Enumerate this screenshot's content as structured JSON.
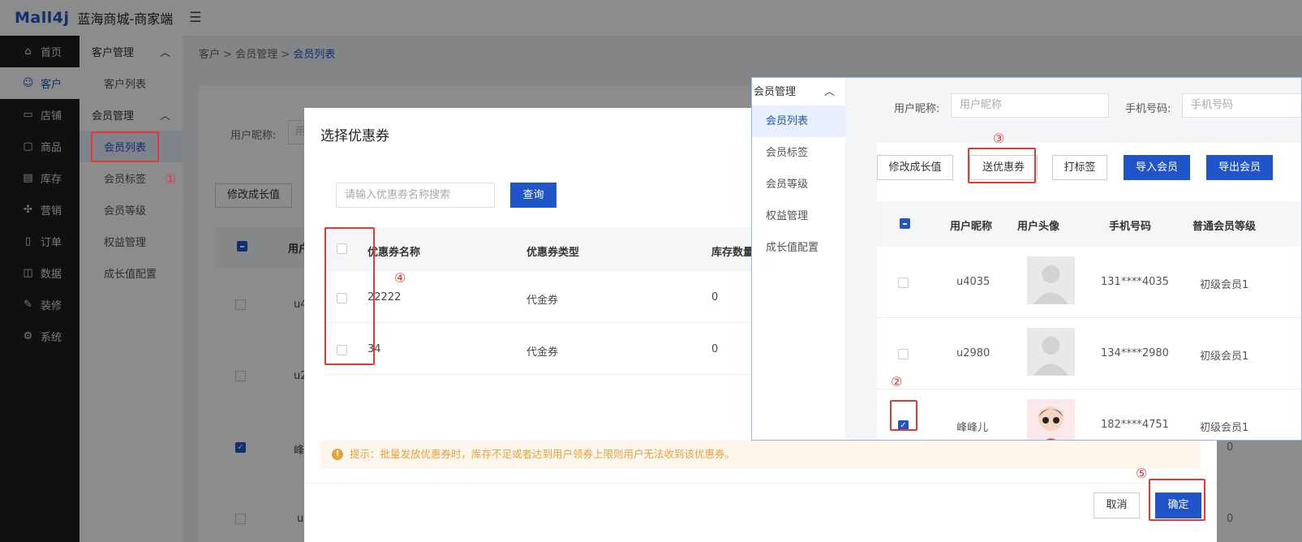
{
  "header": {
    "logo": "Mall4j",
    "app_title": "蓝海商城-商家端",
    "menu_icon": "menu-fold-icon"
  },
  "sidebar": {
    "items": [
      {
        "label": "首页",
        "icon": "home-icon"
      },
      {
        "label": "客户",
        "icon": "users-icon",
        "active": true
      },
      {
        "label": "店铺",
        "icon": "shop-icon"
      },
      {
        "label": "商品",
        "icon": "bag-icon"
      },
      {
        "label": "库存",
        "icon": "store-icon"
      },
      {
        "label": "营销",
        "icon": "gift-icon"
      },
      {
        "label": "订单",
        "icon": "file-icon"
      },
      {
        "label": "数据",
        "icon": "chart-icon"
      },
      {
        "label": "装修",
        "icon": "brush-icon"
      },
      {
        "label": "系统",
        "icon": "gear-icon"
      }
    ]
  },
  "subnav": {
    "group1": "客户管理",
    "group1_items": [
      "客户列表"
    ],
    "group2": "会员管理",
    "group2_items": [
      "会员列表",
      "会员标签",
      "会员等级",
      "权益管理",
      "成长值配置"
    ]
  },
  "breadcrumb": [
    "客户",
    "会员管理",
    "会员列表"
  ],
  "background": {
    "search_label": "用户昵称:",
    "search_placeholder": "用",
    "button": "修改成长值",
    "col_header": "用户",
    "rows": [
      "u4",
      "u2",
      "峰",
      "u"
    ],
    "zero_values": [
      "0",
      "0"
    ]
  },
  "dialog": {
    "title": "选择优惠券",
    "search_placeholder": "请输入优惠券名称搜索",
    "query_button": "查询",
    "columns": [
      "优惠券名称",
      "优惠券类型",
      "库存数量"
    ],
    "rows": [
      {
        "name": "22222",
        "type": "代金券",
        "stock": "0"
      },
      {
        "name": "34",
        "type": "代金券",
        "stock": "0"
      }
    ],
    "tip": "提示：批量发放优惠券时，库存不足或者达到用户领券上限则用户无法收到该优惠券。",
    "cancel": "取消",
    "confirm": "确定"
  },
  "inset": {
    "group": "会员管理",
    "items": [
      "会员列表",
      "会员标签",
      "会员等级",
      "权益管理",
      "成长值配置"
    ],
    "search": {
      "nickname_label": "用户昵称:",
      "nickname_placeholder": "用户昵称",
      "phone_label": "手机号码:",
      "phone_placeholder": "手机号码"
    },
    "buttons": [
      "修改成长值",
      "送优惠券",
      "打标签",
      "导入会员",
      "导出会员"
    ],
    "columns": [
      "用户昵称",
      "用户头像",
      "手机号码",
      "普通会员等级"
    ],
    "rows": [
      {
        "nickname": "u4035",
        "phone": "131****4035",
        "level": "初级会员1",
        "checked": false
      },
      {
        "nickname": "u2980",
        "phone": "134****2980",
        "level": "初级会员1",
        "checked": false
      },
      {
        "nickname": "峰峰儿",
        "phone": "182****4751",
        "level": "初级会员1",
        "checked": true
      }
    ]
  },
  "annotations": [
    "①",
    "②",
    "③",
    "④",
    "⑤"
  ],
  "colors": {
    "primary": "#1f55c9",
    "annotation": "#e53935",
    "warning": "#e6a23c"
  }
}
